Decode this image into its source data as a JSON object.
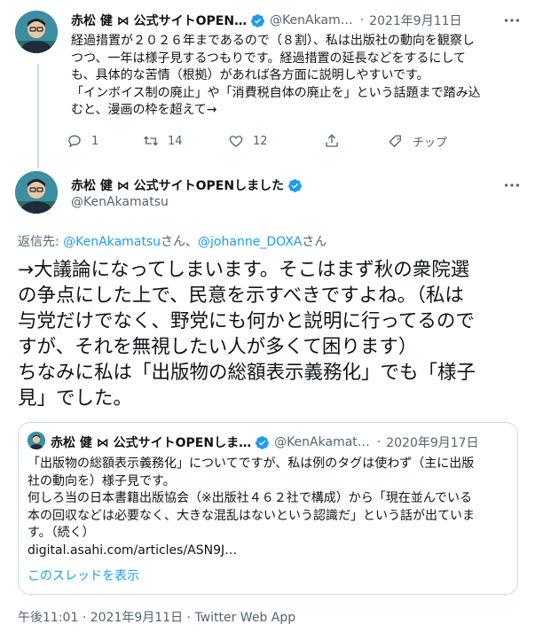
{
  "colors": {
    "accent": "#1d9bf0",
    "muted": "#536471",
    "text": "#0f1419",
    "border": "#cfd9de"
  },
  "tweet1": {
    "display_name": "赤松 健 ⋈ 公式サイトOPEN…",
    "handle": "@KenAkam…",
    "separator": "·",
    "date": "2021年9月11日",
    "lines": [
      "経過措置が２０２６年まであるので（８割）、私は出版社の動向を観察し",
      "つつ、一年は様子見するつもりです。経過措置の延長などをするにして",
      "も、具体的な苦情（根拠）があれば各方面に説明しやすいです。",
      "「インボイス制の廃止」や「消費税自体の廃止を」という話題まで踏み込",
      "むと、漫画の枠を超えて→"
    ],
    "actions": {
      "reply_count": "1",
      "retweet_count": "14",
      "like_count": "12",
      "tip_label": "チップ"
    },
    "icons": [
      "reply-icon",
      "retweet-icon",
      "like-icon",
      "share-icon",
      "tip-icon",
      "more-icon",
      "verified-badge-icon"
    ]
  },
  "tweet2": {
    "display_name": "赤松 健 ⋈ 公式サイトOPENしました",
    "handle": "@KenAkamatsu",
    "reply_prefix": "返信先: ",
    "reply_user1": "@KenAkamatsu",
    "reply_joiner": "さん、",
    "reply_user2": "@johanne_DOXA",
    "reply_suffix": "さん",
    "lines": [
      "→大議論になってしまいます。そこはまず秋の衆院選",
      "の争点にした上で、民意を示すべきですよね。（私は",
      "与党だけでなく、野党にも何かと説明に行ってるので",
      "すが、それを無視したい人が多くて困ります）",
      "ちなみに私は「出版物の総額表示義務化」でも「様子",
      "見」でした。"
    ],
    "footer": {
      "time": "午後11:01",
      "sep1": "·",
      "date": "2021年9月11日",
      "sep2": "·",
      "client": "Twitter Web App"
    }
  },
  "quote": {
    "display_name": "赤松 健 ⋈ 公式サイトOPENしま…",
    "handle": "@KenAkamat…",
    "separator": "·",
    "date": "2020年9月17日",
    "lines": [
      "「出版物の総額表示義務化」についてですが、私は例のタグは使わず（主に出版",
      "社の動向を）様子見です。",
      "何しろ当の日本書籍出版協会（※出版社４６２社で構成）から「現在並んでいる",
      "本の回収などは必要なく、大きな混乱はないという認識だ」という話が出ていま",
      "す。（続く）",
      "digital.asahi.com/articles/ASN9J…"
    ],
    "show_thread": "このスレッドを表示"
  }
}
